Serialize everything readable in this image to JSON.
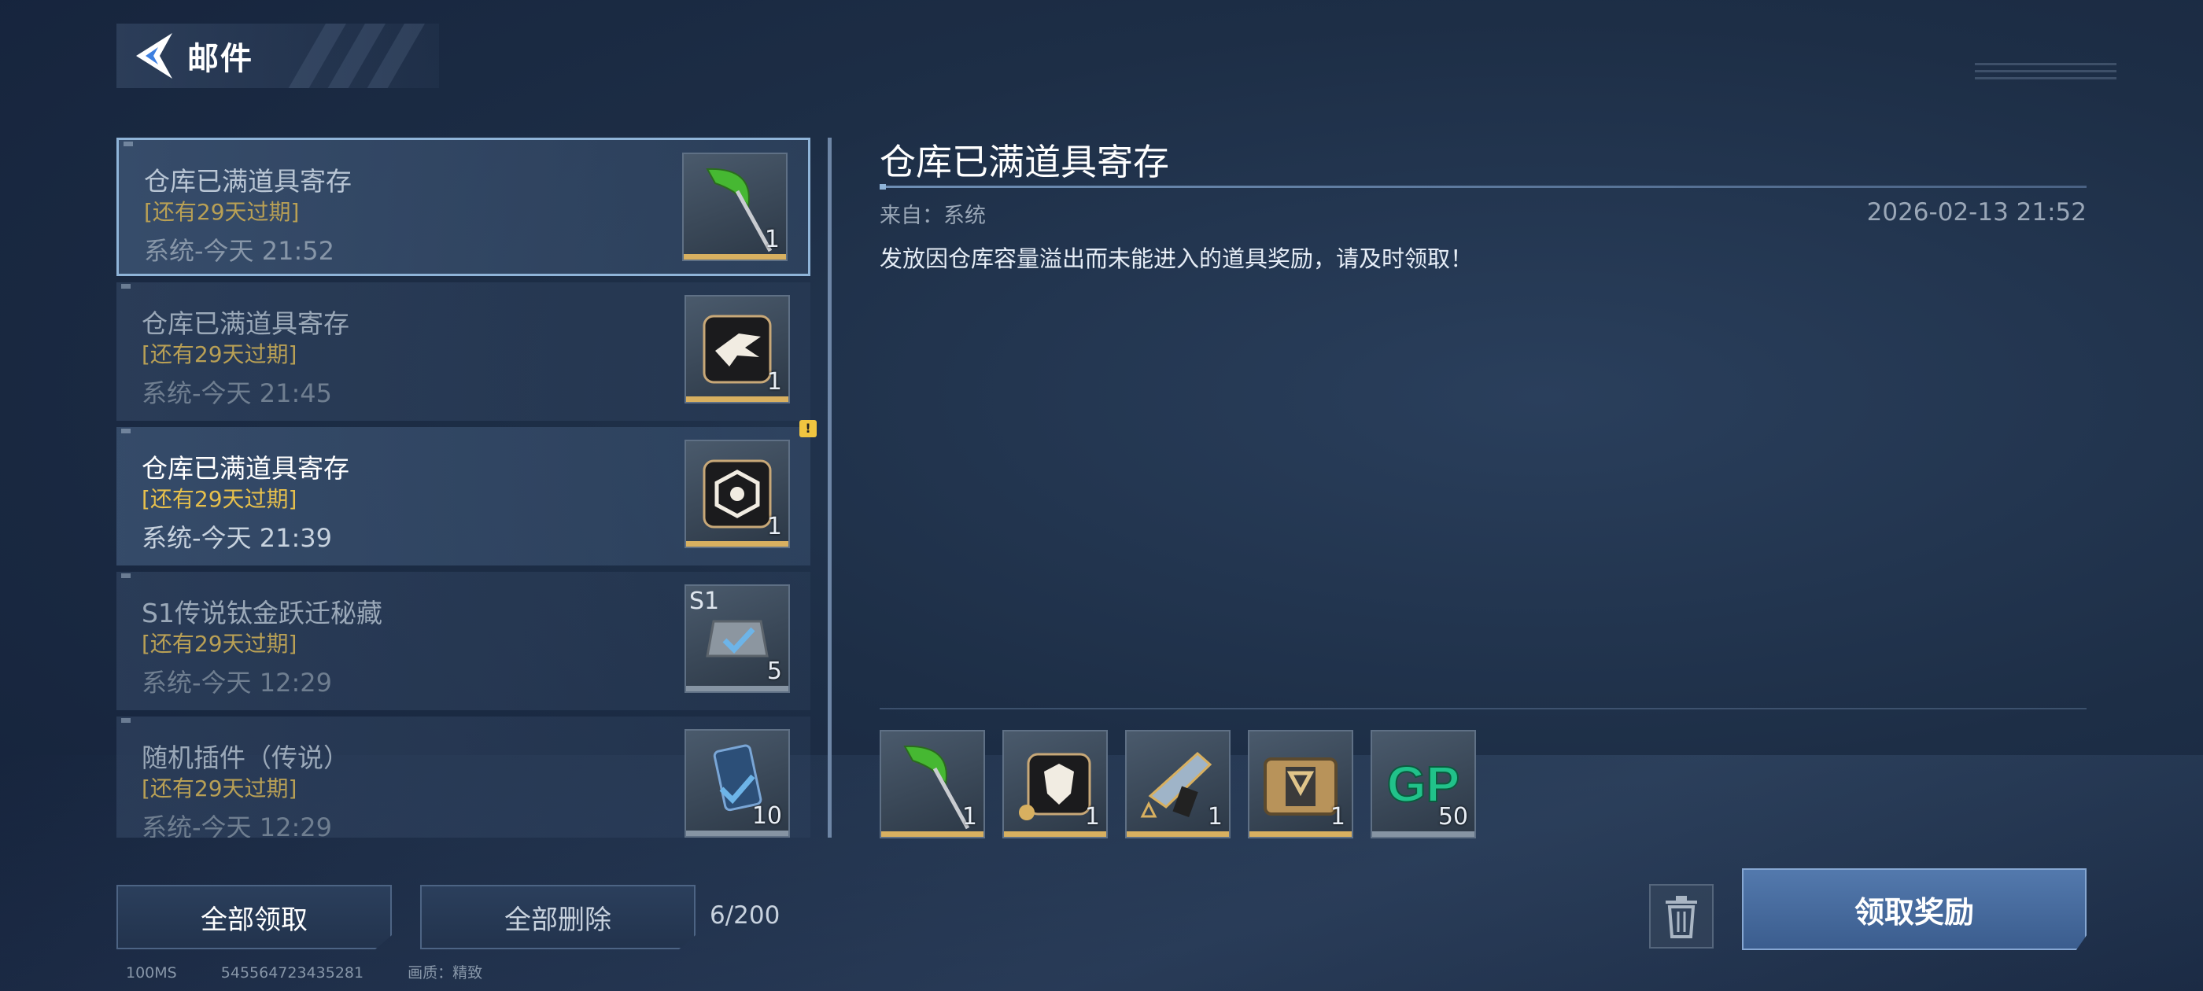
{
  "header": {
    "title": "邮件",
    "back_icon": "back-arrow-icon"
  },
  "mails": [
    {
      "title": "仓库已满道具寄存",
      "expire": "[还有29天过期]",
      "meta": "系统-今天 21:52",
      "item": {
        "icon": "scythe-icon",
        "count": "1",
        "label": ""
      }
    },
    {
      "title": "仓库已满道具寄存",
      "expire": "[还有29天过期]",
      "meta": "系统-今天 21:45",
      "item": {
        "icon": "eagle-emblem-icon",
        "count": "1",
        "label": ""
      }
    },
    {
      "title": "仓库已满道具寄存",
      "expire": "[还有29天过期]",
      "meta": "系统-今天 21:39",
      "item": {
        "icon": "target-emblem-icon",
        "count": "1",
        "label": ""
      }
    },
    {
      "title": "S1传说钛金跃迁秘藏",
      "expire": "[还有29天过期]",
      "meta": "系统-今天 12:29",
      "item": {
        "icon": "chest-icon",
        "count": "5",
        "label": "S1"
      }
    },
    {
      "title": "随机插件（传说）",
      "expire": "[还有29天过期]",
      "meta": "系统-今天 12:29",
      "item": {
        "icon": "plugin-icon",
        "count": "10",
        "label": ""
      }
    }
  ],
  "alert_badge": "!",
  "detail": {
    "title": "仓库已满道具寄存",
    "from": "来自：系统",
    "date": "2026-02-13 21:52",
    "body": "发放因仓库容量溢出而未能进入的道具奖励，请及时领取！",
    "rewards": [
      {
        "icon": "scythe-icon",
        "count": "1"
      },
      {
        "icon": "wolf-emblem-icon",
        "count": "1"
      },
      {
        "icon": "blaster-icon",
        "count": "1"
      },
      {
        "icon": "supply-crate-icon",
        "count": "1"
      },
      {
        "icon": "gp-currency-icon",
        "count": "50",
        "text": "GP"
      }
    ]
  },
  "actions": {
    "claim_all": "全部领取",
    "delete_all": "全部删除",
    "mail_count": "6/200",
    "claim": "领取奖励",
    "trash_icon": "trash-icon"
  },
  "footer": {
    "ping": "100MS",
    "uid": "545564723435281",
    "quality": "画质：精致"
  },
  "colors": {
    "accent_gold": "#e7c04c",
    "button_blue": "#4b6fa3",
    "selected_border": "#8fb4d8"
  }
}
